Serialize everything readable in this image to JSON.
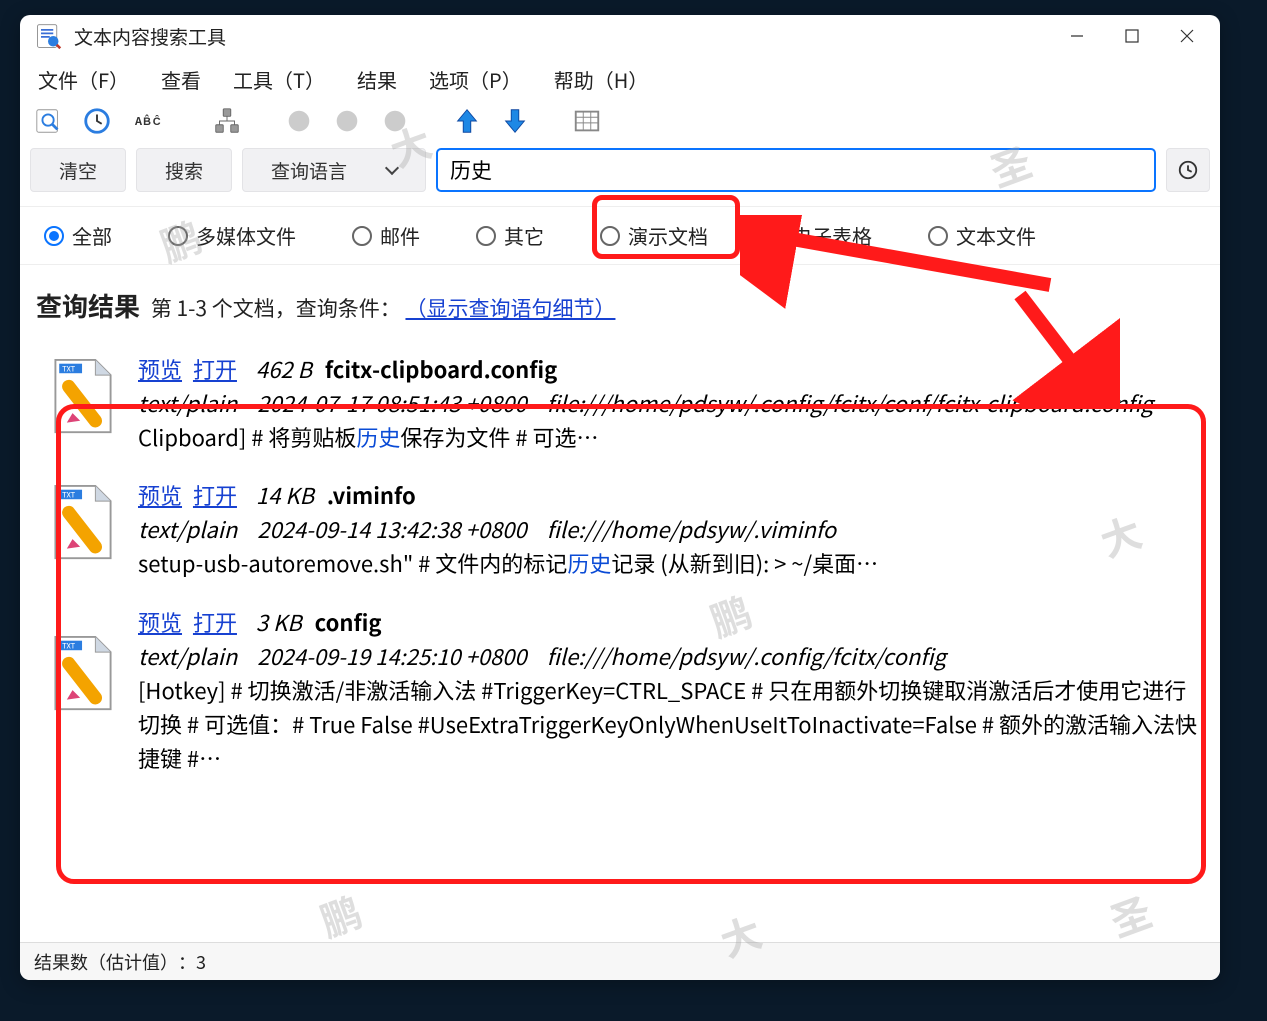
{
  "window": {
    "title": "文本内容搜索工具"
  },
  "menu": {
    "file": "文件（F）",
    "view": "查看",
    "tools": "工具（T）",
    "results": "结果",
    "options": "选项（P）",
    "help": "帮助（H）"
  },
  "toolbar_icons": {
    "find": "find-icon",
    "clock": "clock-icon",
    "abc": "abc-icon",
    "tree": "tree-icon",
    "dot1": "dot-disabled-icon",
    "dot2": "dot-disabled-icon",
    "dot3": "dot-disabled-icon",
    "up": "arrow-up-icon",
    "down": "arrow-down-icon",
    "calendar": "calendar-icon"
  },
  "search": {
    "clear": "清空",
    "search": "搜索",
    "lang": "查询语言",
    "value": "历史",
    "history_icon": "history-icon"
  },
  "filters": {
    "all": "全部",
    "multimedia": "多媒体文件",
    "mail": "邮件",
    "other": "其它",
    "presentation": "演示文档",
    "spreadsheet": "电子表格",
    "text": "文本文件",
    "selected": "all"
  },
  "results_header": {
    "title": "查询结果",
    "range": "第 1-3 个文档，查询条件：",
    "show_details": "（显示查询语句细节）"
  },
  "results": [
    {
      "preview": "预览",
      "open": "打开",
      "size": "462 B",
      "filename": "fcitx-clipboard.config",
      "mime": "text/plain",
      "date": "2024-07-17 08:51:43 +0800",
      "path": "file:///home/pdsyw/.config/fcitx/conf/fcitx-clipboard.config",
      "snippet_before": "Clipboard] # 将剪贴板",
      "snippet_hl": "历史",
      "snippet_after": "保存为文件 # 可选…"
    },
    {
      "preview": "预览",
      "open": "打开",
      "size": "14 KB",
      "filename": ".viminfo",
      "mime": "text/plain",
      "date": "2024-09-14 13:42:38 +0800",
      "path": "file:///home/pdsyw/.viminfo",
      "snippet_before": "setup-usb-autoremove.sh\" # 文件内的标记",
      "snippet_hl": "历史",
      "snippet_after": "记录 (从新到旧): > ~/桌面…"
    },
    {
      "preview": "预览",
      "open": "打开",
      "size": "3 KB",
      "filename": "config",
      "mime": "text/plain",
      "date": "2024-09-19 14:25:10 +0800",
      "path": "file:///home/pdsyw/.config/fcitx/config",
      "snippet_before": "[Hotkey] # 切换激活/非激活输入法 #TriggerKey=CTRL_SPACE # 只在用额外切换键取消激活后才使用它进行切换 # 可选值：# True False #UseExtraTriggerKeyOnlyWhenUseItToInactivate=False # 额外的激活输入法快捷键 #…",
      "snippet_hl": "",
      "snippet_after": ""
    }
  ],
  "status": {
    "label": "结果数（估计值）",
    "value": "3"
  },
  "watermarks": [
    "鹏",
    "大",
    "圣",
    "鹏",
    "大",
    "圣",
    "鹏",
    "大",
    "圣"
  ]
}
